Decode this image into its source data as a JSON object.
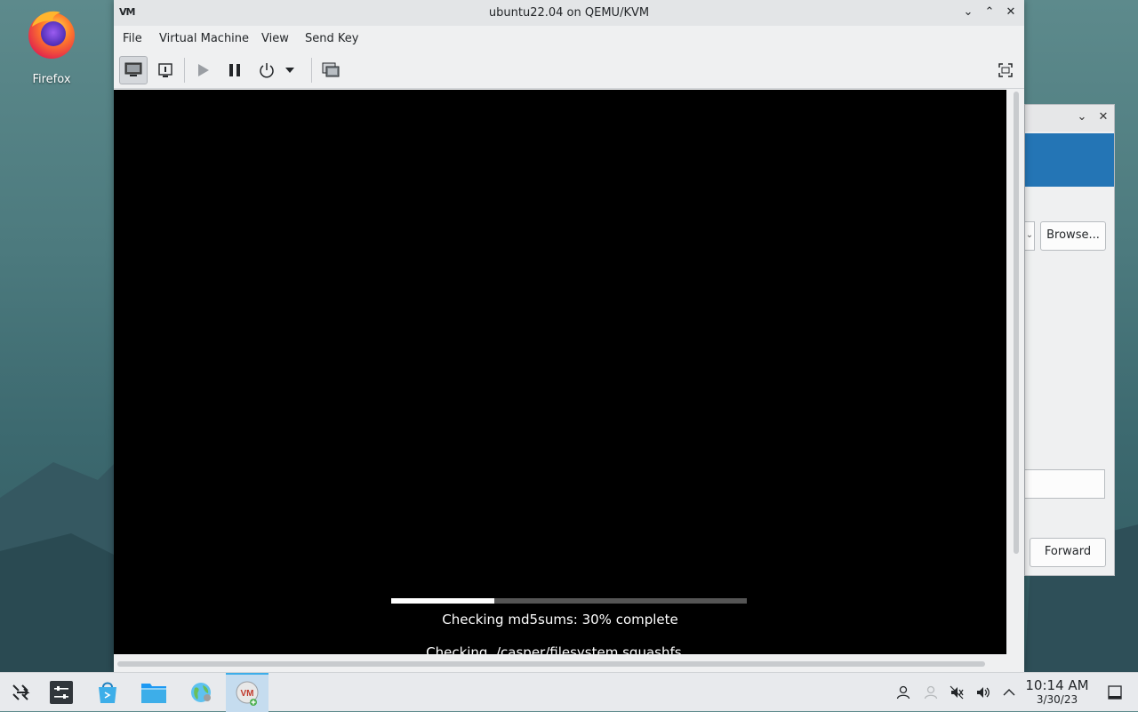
{
  "desktop": {
    "firefox_label": "Firefox"
  },
  "bg_dialog": {
    "browse_label": "Browse...",
    "forward_label": "Forward",
    "banner_color": "#2475b5"
  },
  "window": {
    "app_icon_text": "VM",
    "title": "ubuntu22.04 on QEMU/KVM",
    "menu": {
      "file": "File",
      "virtual_machine": "Virtual Machine",
      "view": "View",
      "send_key": "Send Key"
    },
    "toolbar_icons": [
      "console-icon",
      "details-icon",
      "run-icon",
      "pause-icon",
      "power-icon",
      "dropdown-icon",
      "snapshots-icon",
      "fullscreen-icon"
    ]
  },
  "vm_screen": {
    "progress_fraction": 0.29,
    "status_line": "Checking md5sums: 30% complete",
    "file_line": "Checking ./casper/filesystem.squashfs..."
  },
  "taskbar": {
    "time": "10:14 AM",
    "date": "3/30/23",
    "accent": "#3daee9"
  }
}
